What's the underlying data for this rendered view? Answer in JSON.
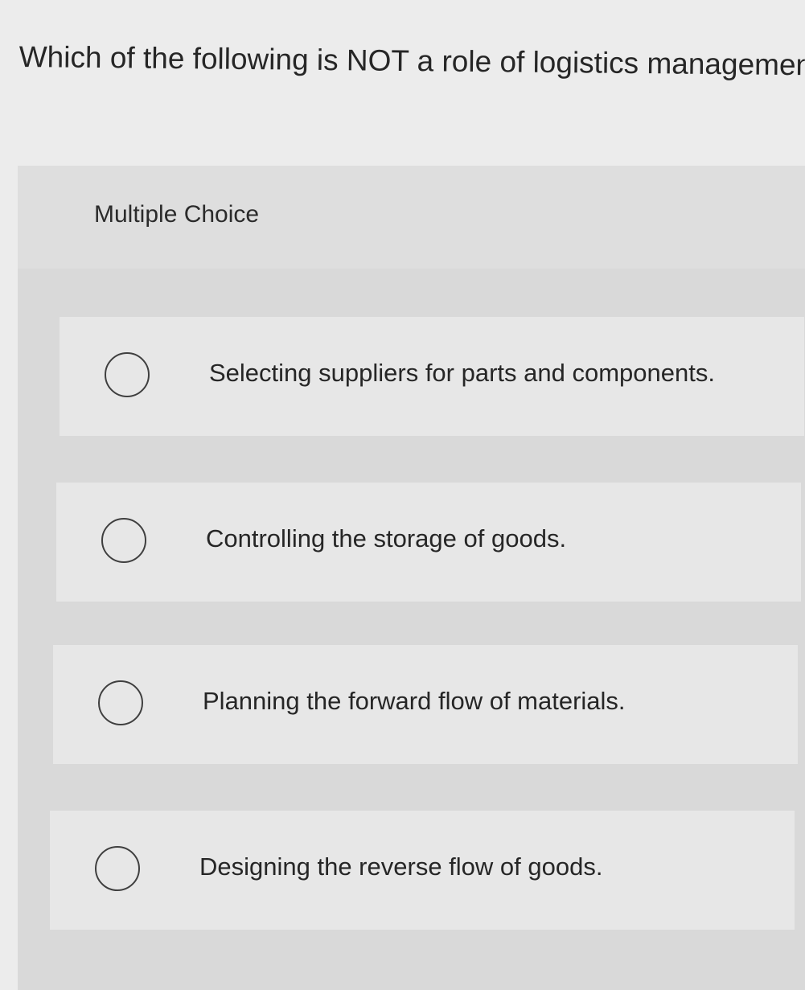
{
  "question": {
    "text": "Which of the following is NOT a role of logistics management?"
  },
  "panel": {
    "label": "Multiple Choice"
  },
  "options": [
    {
      "label": "Selecting suppliers for parts and components."
    },
    {
      "label": "Controlling the storage of goods."
    },
    {
      "label": "Planning the forward flow of materials."
    },
    {
      "label": "Designing the reverse flow of goods."
    }
  ],
  "icons": {
    "radio": "radio-circle-icon"
  },
  "colors": {
    "page_background": "#ececec",
    "panel_background": "#d9d9d9",
    "option_background": "#e7e7e7",
    "text": "#262626"
  }
}
